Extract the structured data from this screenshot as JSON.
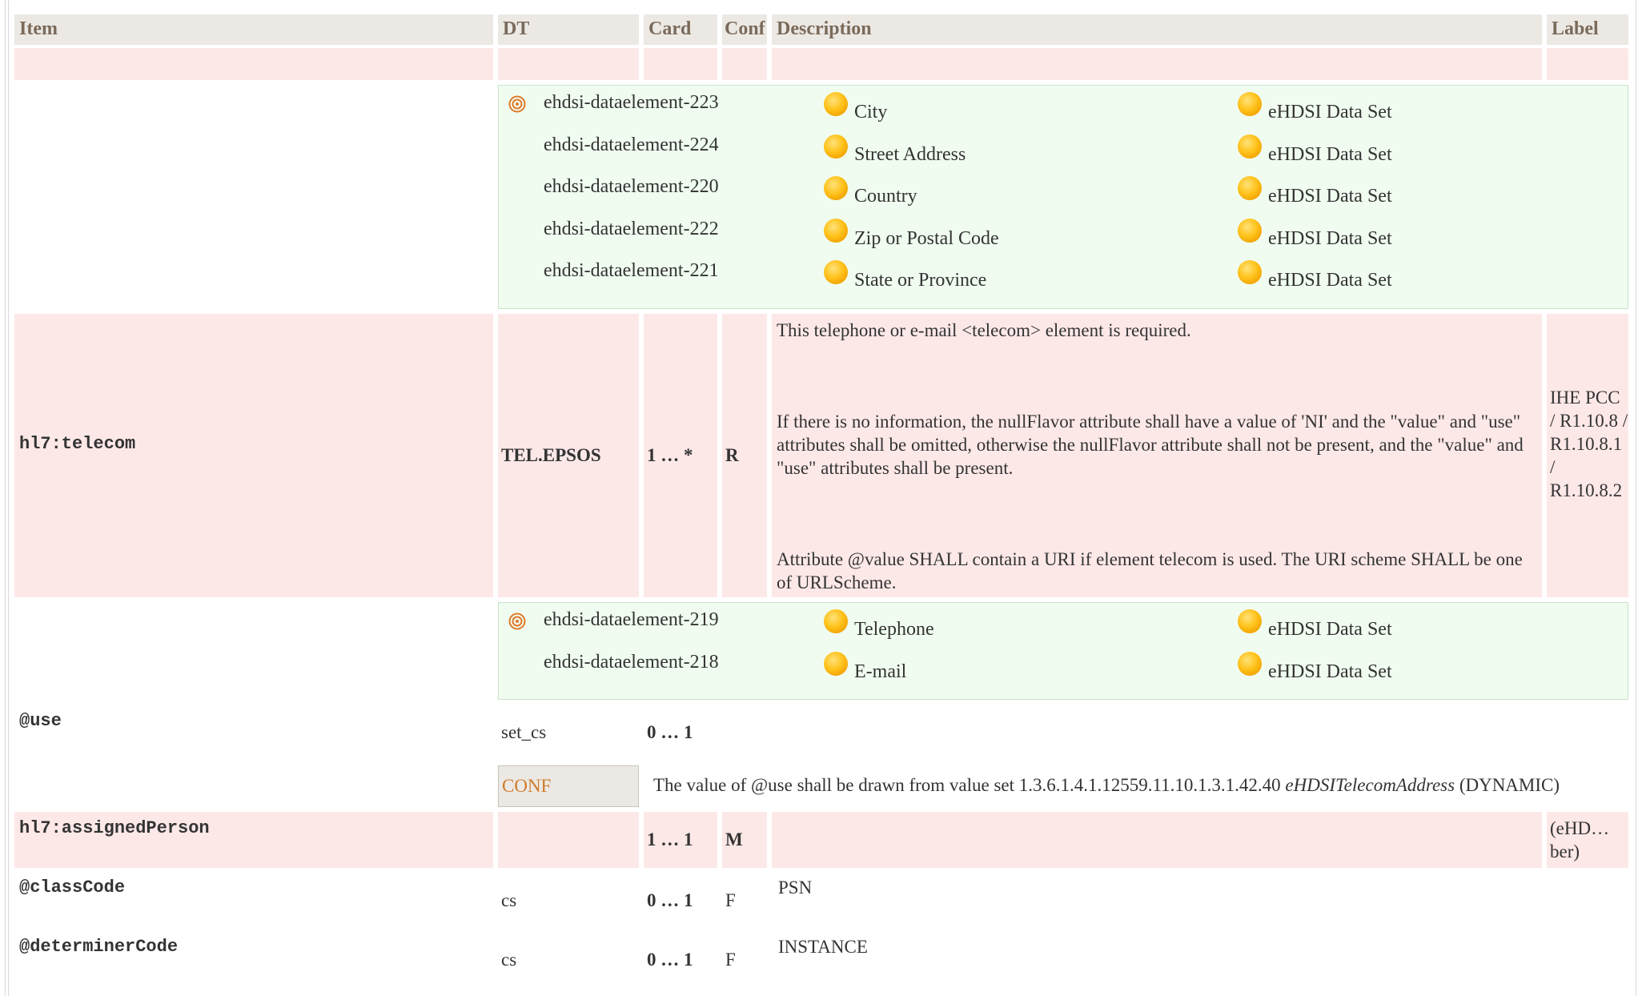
{
  "header": {
    "item": "Item",
    "dt": "DT",
    "card": "Card",
    "conf": "Conf",
    "description": "Description",
    "label": "Label"
  },
  "address_concepts": [
    {
      "id": "ehdsi-dataelement-223",
      "name": "City",
      "dataset": "eHDSI Data Set",
      "has_target": true
    },
    {
      "id": "ehdsi-dataelement-224",
      "name": "Street Address",
      "dataset": "eHDSI Data Set",
      "has_target": false
    },
    {
      "id": "ehdsi-dataelement-220",
      "name": "Country",
      "dataset": "eHDSI Data Set",
      "has_target": false
    },
    {
      "id": "ehdsi-dataelement-222",
      "name": "Zip or Postal Code",
      "dataset": "eHDSI Data Set",
      "has_target": false
    },
    {
      "id": "ehdsi-dataelement-221",
      "name": "State or Province",
      "dataset": "eHDSI Data Set",
      "has_target": false
    }
  ],
  "telecom": {
    "item": "hl7:telecom",
    "dt": "TEL.EPSOS",
    "card": "1 … *",
    "conf": "R",
    "desc1": "This telephone or e-mail <telecom> element is required.",
    "desc2": "If there is no information, the nullFlavor attribute shall have a value of 'NI' and the \"value\" and \"use\" attributes shall be omitted, otherwise the nullFlavor attribute shall not be present, and the \"value\" and \"use\" attributes shall be present.",
    "desc3": "Attribute @value SHALL contain a URI if element telecom is used. The URI scheme SHALL be one of URLScheme.",
    "label": "IHE PCC / R1.10.8 / R1.10.8.1 / R1.10.8.2"
  },
  "telecom_concepts": [
    {
      "id": "ehdsi-dataelement-219",
      "name": "Telephone",
      "dataset": "eHDSI Data Set",
      "has_target": true
    },
    {
      "id": "ehdsi-dataelement-218",
      "name": "E-mail",
      "dataset": "eHDSI Data Set",
      "has_target": false
    }
  ],
  "use": {
    "item": "@use",
    "dt": "set_cs",
    "card": "0 … 1",
    "conf_label": "CONF",
    "conf_text_pre": "The value of @use shall be drawn from value set 1.3.6.1.4.1.12559.11.10.1.3.1.42.40 ",
    "conf_text_em": "eHDSITelecomAddress",
    "conf_text_post": " (DYNAMIC)"
  },
  "assigned_person": {
    "item": "hl7:assignedPerson",
    "card": "1 … 1",
    "conf": "M",
    "label": "(eHD… ber)"
  },
  "class_code": {
    "item": "@classCode",
    "dt": "cs",
    "card": "0 … 1",
    "conf": "F",
    "desc": "PSN"
  },
  "determiner_code": {
    "item": "@determinerCode",
    "dt": "cs",
    "card": "0 … 1",
    "conf": "F",
    "desc": "INSTANCE"
  },
  "colors": {
    "header_bg": "#ece9e4",
    "header_text": "#7a6a5a",
    "pink_row": "#fde8e8",
    "green_box": "#f0fcf0",
    "conf_orange": "#d07a2a"
  },
  "icons": {
    "concept": "target-icon",
    "dataset_bullet": "yellow-ball-icon"
  }
}
